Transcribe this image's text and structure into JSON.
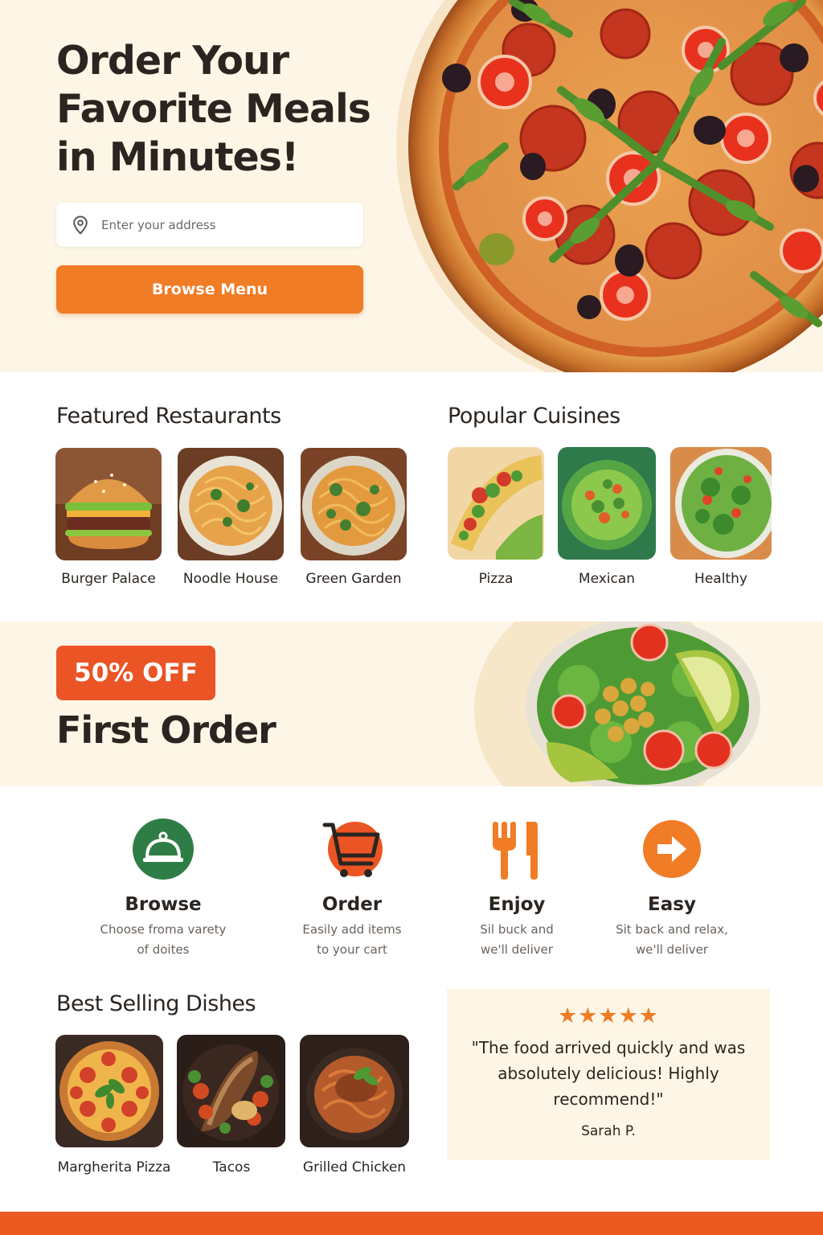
{
  "hero": {
    "title": "Order Your Favorite Meals in Minutes!",
    "address_placeholder": "Enter your address",
    "cta_label": "Browse Menu"
  },
  "featured": {
    "title": "Featured Restaurants",
    "items": [
      {
        "label": "Burger Palace",
        "image": "burger"
      },
      {
        "label": "Noodle House",
        "image": "noodles"
      },
      {
        "label": "Green Garden",
        "image": "noodles-broccoli"
      }
    ]
  },
  "cuisines": {
    "title": "Popular Cuisines",
    "items": [
      {
        "label": "Pizza",
        "image": "taco"
      },
      {
        "label": "Mexican",
        "image": "salad-bowl-green"
      },
      {
        "label": "Healthy",
        "image": "salad"
      }
    ]
  },
  "promo": {
    "badge": "50% OFF",
    "title": "First Order"
  },
  "steps": [
    {
      "title": "Browse",
      "desc": "Choose froma varety of doites",
      "icon": "cloche-icon"
    },
    {
      "title": "Order",
      "desc": "Easily add items to your cart",
      "icon": "cart-icon"
    },
    {
      "title": "Enjoy",
      "desc": "Sil buck and we'll deliver",
      "icon": "utensils-icon"
    },
    {
      "title": "Easy",
      "desc": "Sit back and relax, we'll deliver",
      "icon": "arrow-icon"
    }
  ],
  "best_selling": {
    "title": "Best Selling Dishes",
    "items": [
      {
        "label": "Margherita Pizza",
        "image": "pizza"
      },
      {
        "label": "Tacos",
        "image": "tacos"
      },
      {
        "label": "Grilled Chicken",
        "image": "chicken"
      }
    ]
  },
  "testimonial": {
    "stars": "★★★★★",
    "rating": 5,
    "quote": "\"The food arrived quickly and was absolutely delicious! Highly recommend!\"",
    "author": "Sarah P."
  },
  "colors": {
    "accent": "#f07c26",
    "badge": "#eb5424",
    "green": "#2e7d46",
    "cream": "#fdf6e6"
  }
}
